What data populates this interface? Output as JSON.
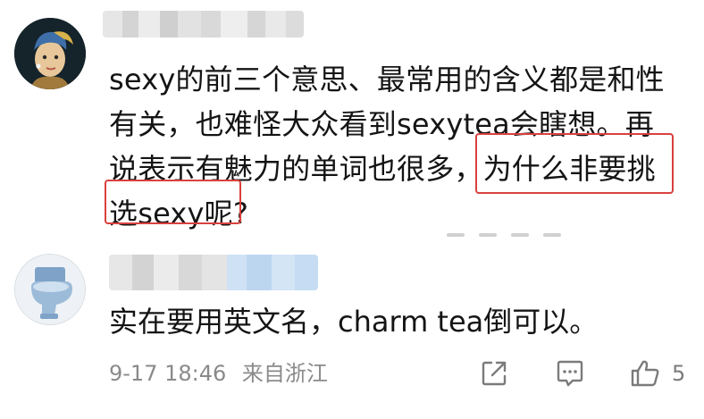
{
  "comments": [
    {
      "username": "",
      "content_lines": [
        "sexy的前三个意思、最常用的含义都是和性",
        "有关，也难怪大众看到sexytea会瞎想。再",
        "说表示有魅力的单词也很多，为什么非要挑",
        "选sexy呢?"
      ],
      "highlight_text": "为什么非要挑选sexy呢?"
    },
    {
      "username": "",
      "content": "实在要用英文名，charm tea倒可以。",
      "date": "9-17 18:46",
      "location": "来自浙江",
      "like_count": "5"
    }
  ],
  "colors": {
    "highlight_border": "#d9413f",
    "meta_text": "#8a8a8a",
    "body_text": "#141414"
  },
  "icons": [
    "share-icon",
    "comment-icon",
    "like-icon"
  ]
}
